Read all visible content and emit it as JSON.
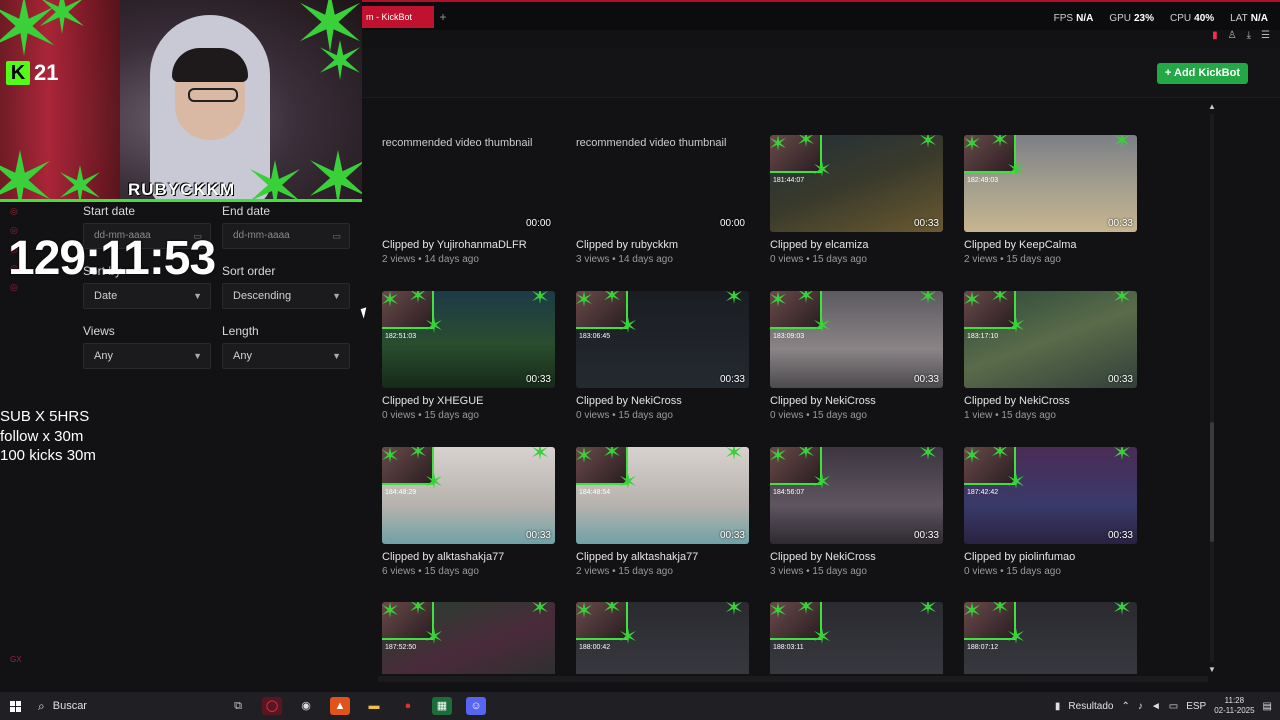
{
  "browser": {
    "tab_title": "m - KickBot",
    "tab_add": "+",
    "stats": [
      {
        "label": "FPS",
        "value": "N/A"
      },
      {
        "label": "GPU",
        "value": "23%"
      },
      {
        "label": "CPU",
        "value": "40%"
      },
      {
        "label": "LAT",
        "value": "N/A"
      }
    ]
  },
  "header": {
    "add_button": "+ Add KickBot"
  },
  "stream_overlay": {
    "kick_count": "21",
    "kick_letter": "K",
    "streamer_name": "RUBYCKKM",
    "timer": "129:11:53",
    "rules": [
      "SUB X 5HRS",
      "follow x 30m",
      "100 kicks 30m"
    ]
  },
  "filters": {
    "start_date": {
      "label": "Start date",
      "placeholder": "dd-mm-aaaa"
    },
    "end_date": {
      "label": "End date",
      "placeholder": "dd-mm-aaaa"
    },
    "sort_by": {
      "label": "Sort by",
      "value": "Date"
    },
    "sort_order": {
      "label": "Sort order",
      "value": "Descending"
    },
    "views": {
      "label": "Views",
      "value": "Any"
    },
    "length": {
      "label": "Length",
      "value": "Any"
    }
  },
  "clips": {
    "broken_alt": "recommended video thumbnail",
    "rows": [
      [
        {
          "by": "Clipped by YujirohanmaDLFR",
          "meta": "2 views • 14 days ago",
          "duration": "00:00",
          "thumb": "broken"
        },
        {
          "by": "Clipped by rubyckkm",
          "meta": "3 views • 14 days ago",
          "duration": "00:00",
          "thumb": "broken"
        },
        {
          "by": "Clipped by elcamiza",
          "meta": "0 views • 15 days ago",
          "duration": "00:33",
          "thumb": "valorant-dark",
          "timecode": "181:44:07"
        },
        {
          "by": "Clipped by KeepCalma",
          "meta": "2 views • 15 days ago",
          "duration": "00:33",
          "thumb": "valorant-sand",
          "timecode": "182:49:03"
        }
      ],
      [
        {
          "by": "Clipped by XHEGUE",
          "meta": "0 views • 15 days ago",
          "duration": "00:33",
          "thumb": "lotus",
          "timecode": "182:51:03"
        },
        {
          "by": "Clipped by NekiCross",
          "meta": "0 views • 15 days ago",
          "duration": "00:33",
          "thumb": "desktop",
          "timecode": "183:06:45"
        },
        {
          "by": "Clipped by NekiCross",
          "meta": "0 views • 15 days ago",
          "duration": "00:33",
          "thumb": "valorant-grey",
          "timecode": "183:09:03"
        },
        {
          "by": "Clipped by NekiCross",
          "meta": "1 view • 15 days ago",
          "duration": "00:33",
          "thumb": "lol-map",
          "timecode": "183:17:10"
        }
      ],
      [
        {
          "by": "Clipped by alktashakja77",
          "meta": "6 views • 15 days ago",
          "duration": "00:33",
          "thumb": "room",
          "timecode": "184:48:29"
        },
        {
          "by": "Clipped by alktashakja77",
          "meta": "2 views • 15 days ago",
          "duration": "00:33",
          "thumb": "room",
          "timecode": "184:48:54"
        },
        {
          "by": "Clipped by NekiCross",
          "meta": "3 views • 15 days ago",
          "duration": "00:33",
          "thumb": "webcam",
          "timecode": "184:56:07"
        },
        {
          "by": "Clipped by piolinfumao",
          "meta": "0 views • 15 days ago",
          "duration": "00:33",
          "thumb": "lol-select",
          "timecode": "187:42:42"
        }
      ],
      [
        {
          "by": "",
          "meta": "",
          "duration": "",
          "thumb": "lol-fight",
          "timecode": "187:52:50"
        },
        {
          "by": "",
          "meta": "",
          "duration": "",
          "thumb": "multi-cam",
          "timecode": "188:00:42"
        },
        {
          "by": "",
          "meta": "",
          "duration": "",
          "thumb": "multi-cam",
          "timecode": "188:03:11"
        },
        {
          "by": "",
          "meta": "",
          "duration": "",
          "thumb": "multi-cam",
          "timecode": "188:07:12"
        }
      ]
    ]
  },
  "taskbar": {
    "search_label": "Buscar",
    "tray_label": "Resultado",
    "lang": "ESP",
    "time": "11:28",
    "date": "02-11-2025"
  },
  "colors": {
    "kick_green": "#53fc18",
    "add_button": "#22a845",
    "tab_red": "#c0112e",
    "overlay_green": "#3ee13e"
  }
}
